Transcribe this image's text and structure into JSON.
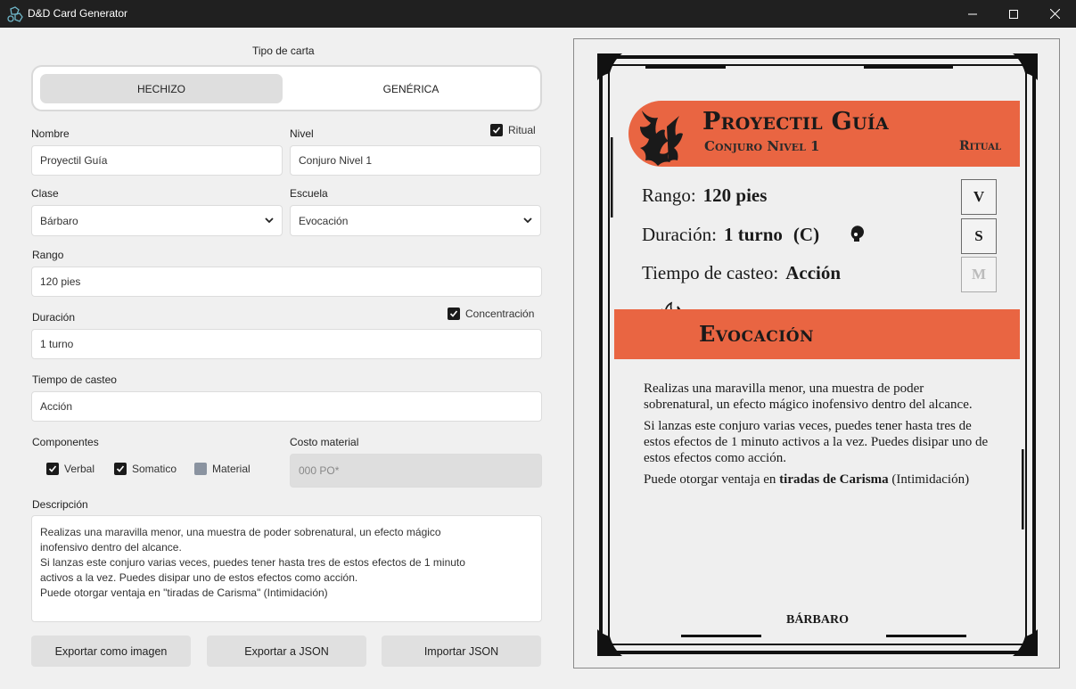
{
  "window": {
    "title": "D&D Card Generator"
  },
  "card_type": {
    "label": "Tipo de carta",
    "options": [
      "HECHIZO",
      "GENÉRICA"
    ],
    "selected": "HECHIZO"
  },
  "form": {
    "nombre": {
      "label": "Nombre",
      "value": "Proyectil Guía"
    },
    "nivel": {
      "label": "Nivel",
      "value": "Conjuro Nivel 1"
    },
    "ritual": {
      "label": "Ritual",
      "checked": true
    },
    "clase": {
      "label": "Clase",
      "value": "Bárbaro"
    },
    "escuela": {
      "label": "Escuela",
      "value": "Evocación"
    },
    "rango": {
      "label": "Rango",
      "value": "120 pies"
    },
    "duracion": {
      "label": "Duración",
      "value": "1 turno"
    },
    "concentracion": {
      "label": "Concentración",
      "checked": true
    },
    "tiempo": {
      "label": "Tiempo de casteo",
      "value": "Acción"
    },
    "componentes": {
      "label": "Componentes",
      "verbal": {
        "label": "Verbal",
        "checked": true
      },
      "somatico": {
        "label": "Somatico",
        "checked": true
      },
      "material": {
        "label": "Material",
        "checked": false
      }
    },
    "costo": {
      "label": "Costo material",
      "placeholder": "000 PO*"
    },
    "descripcion": {
      "label": "Descripción",
      "value": "Realizas una maravilla menor, una muestra de poder sobrenatural, un efecto mágico\ninofensivo dentro del alcance.\nSi lanzas este conjuro varias veces, puedes tener hasta tres de estos efectos de 1 minuto\nactivos a la vez. Puedes disipar uno de estos efectos como acción.\nPuede otorgar ventaja en \"tiradas de Carisma\" (Intimidación)"
    }
  },
  "buttons": {
    "export_image": "Exportar como imagen",
    "export_json": "Exportar a JSON",
    "import_json": "Importar JSON"
  },
  "card": {
    "title": "Proyectil Guía",
    "subtitle": "Conjuro Nivel 1",
    "ritual": "Ritual",
    "range_label": "Rango:",
    "range_value": "120 pies",
    "duration_label": "Duración:",
    "duration_value": "1 turno",
    "duration_conc": "(C)",
    "cast_label": "Tiempo de casteo:",
    "cast_value": "Acción",
    "components": [
      "V",
      "S",
      "M"
    ],
    "school": "Evocación",
    "text": {
      "p1": "Realizas una maravilla menor, una muestra de poder sobrenatural, un efecto mágico inofensivo dentro del alcance.",
      "p2": "Si lanzas este conjuro varias veces, puedes tener hasta tres de estos efectos de 1 minuto activos a la vez. Puedes disipar uno de estos efectos como acción.",
      "p3_prefix": "Puede otorgar ventaja en",
      "p3_bold": "tiradas de Carisma",
      "p3_suffix": "(Intimidación)"
    },
    "class": "BÁRBARO"
  },
  "colors": {
    "accent": "#e96542",
    "titlebar": "#202020"
  },
  "icons": [
    "dice-icon",
    "minimize-icon",
    "maximize-icon",
    "close-icon",
    "chevron-down-icon",
    "check-icon",
    "dragon-icon",
    "concentration-head-icon",
    "fire-hand-icon"
  ]
}
